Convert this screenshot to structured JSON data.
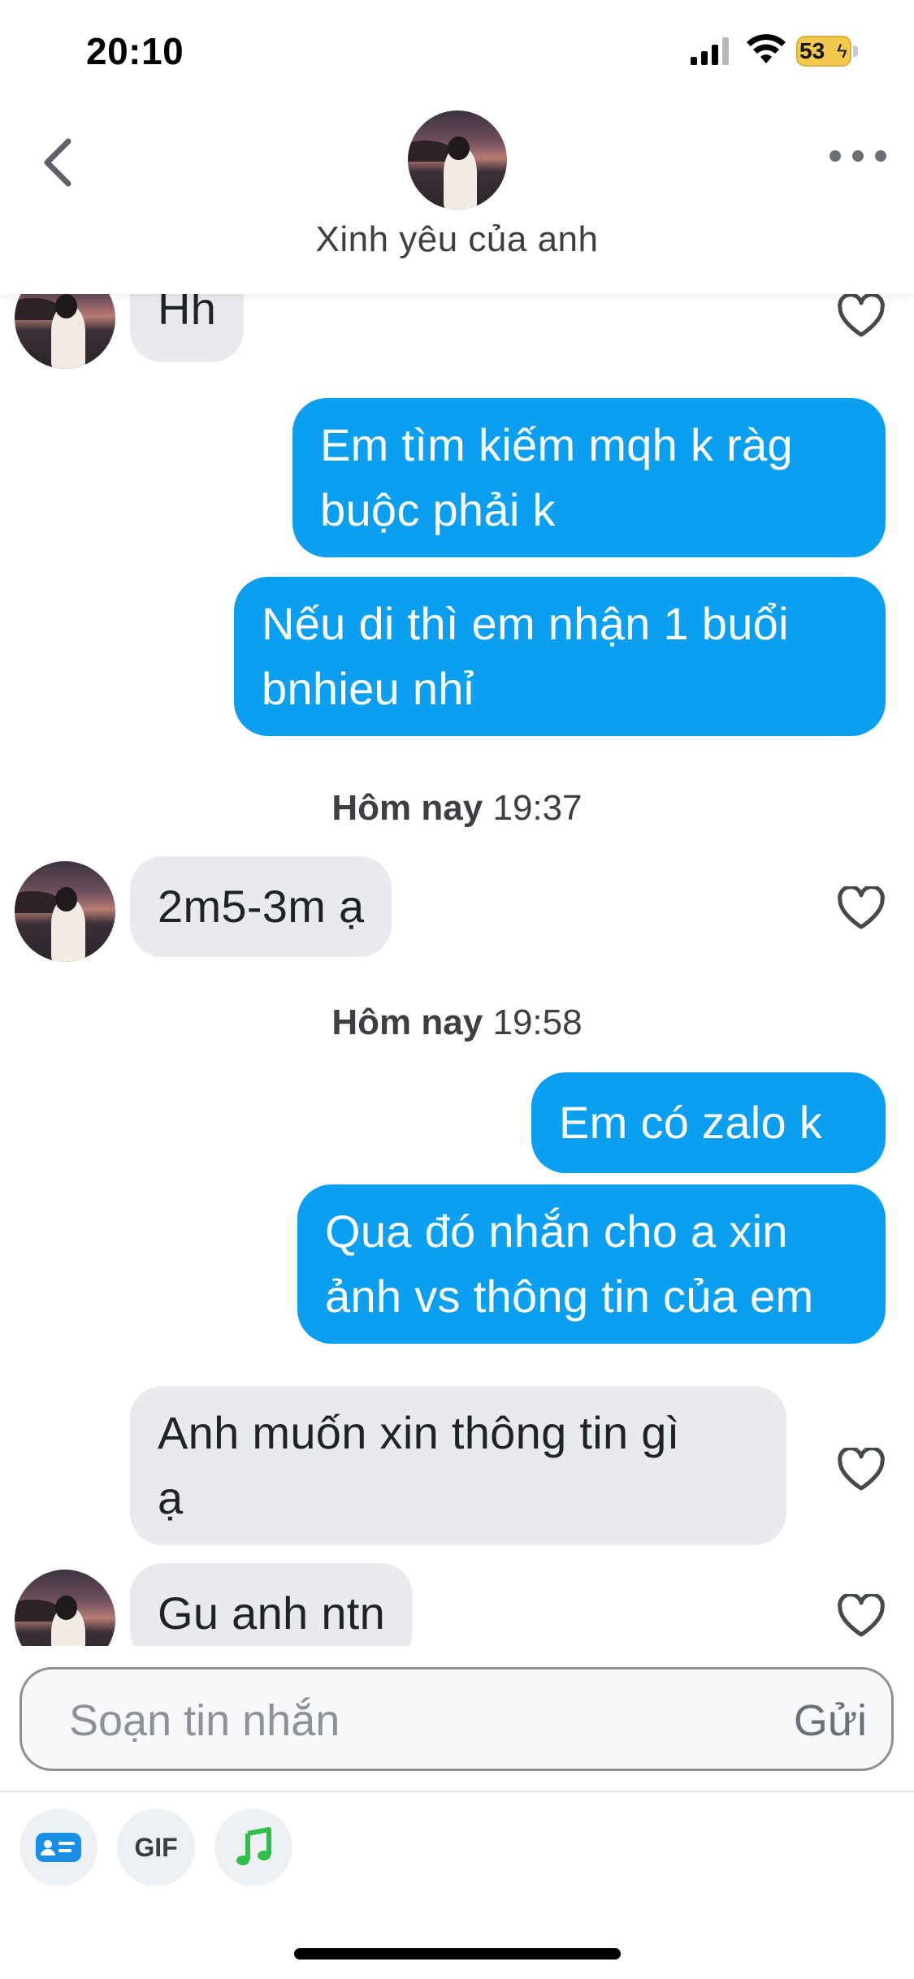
{
  "status_bar": {
    "time": "20:10",
    "battery": "53",
    "icons": [
      "cellular-signal-icon",
      "wifi-icon",
      "battery-charging-icon"
    ]
  },
  "header": {
    "contact_name": "Xinh yêu của anh",
    "back_icon": "chevron-left-icon",
    "more_icon": "ellipsis-icon"
  },
  "messages": [
    {
      "direction": "in",
      "text": "Hh",
      "show_avatar": true,
      "heart": true
    },
    {
      "direction": "out",
      "lines": [
        "Em tìm kiếm mqh k ràg",
        "buộc phải k"
      ]
    },
    {
      "direction": "out",
      "lines": [
        "Nếu di thì em nhận 1 buổi",
        "bnhieu nhỉ"
      ]
    },
    {
      "type": "timestamp",
      "bold": "Hôm nay",
      "time": "19:37"
    },
    {
      "direction": "in",
      "text": "2m5-3m ạ",
      "show_avatar": true,
      "heart": true
    },
    {
      "type": "timestamp",
      "bold": "Hôm nay",
      "time": "19:58"
    },
    {
      "direction": "out",
      "text": "Em có zalo k"
    },
    {
      "direction": "out",
      "lines": [
        "Qua đó nhắn cho a xin",
        "ảnh vs thông tin của em"
      ]
    },
    {
      "direction": "in",
      "lines": [
        "Anh muốn xin thông tin gì",
        "ạ"
      ],
      "show_avatar": false,
      "heart": true
    },
    {
      "direction": "in",
      "text": "Gu anh ntn",
      "show_avatar": true,
      "heart": true
    }
  ],
  "composer": {
    "placeholder": "Soạn tin nhắn",
    "send_label": "Gửi"
  },
  "toolbar": {
    "items": [
      {
        "name": "contact-card-icon"
      },
      {
        "name": "gif-button",
        "label": "GIF"
      },
      {
        "name": "music-note-icon"
      }
    ]
  },
  "colors": {
    "outgoing_bubble": "#0a9ff0",
    "incoming_bubble": "#e9eaed",
    "music_icon": "#2fbf4a",
    "card_icon": "#1a8fe6"
  }
}
